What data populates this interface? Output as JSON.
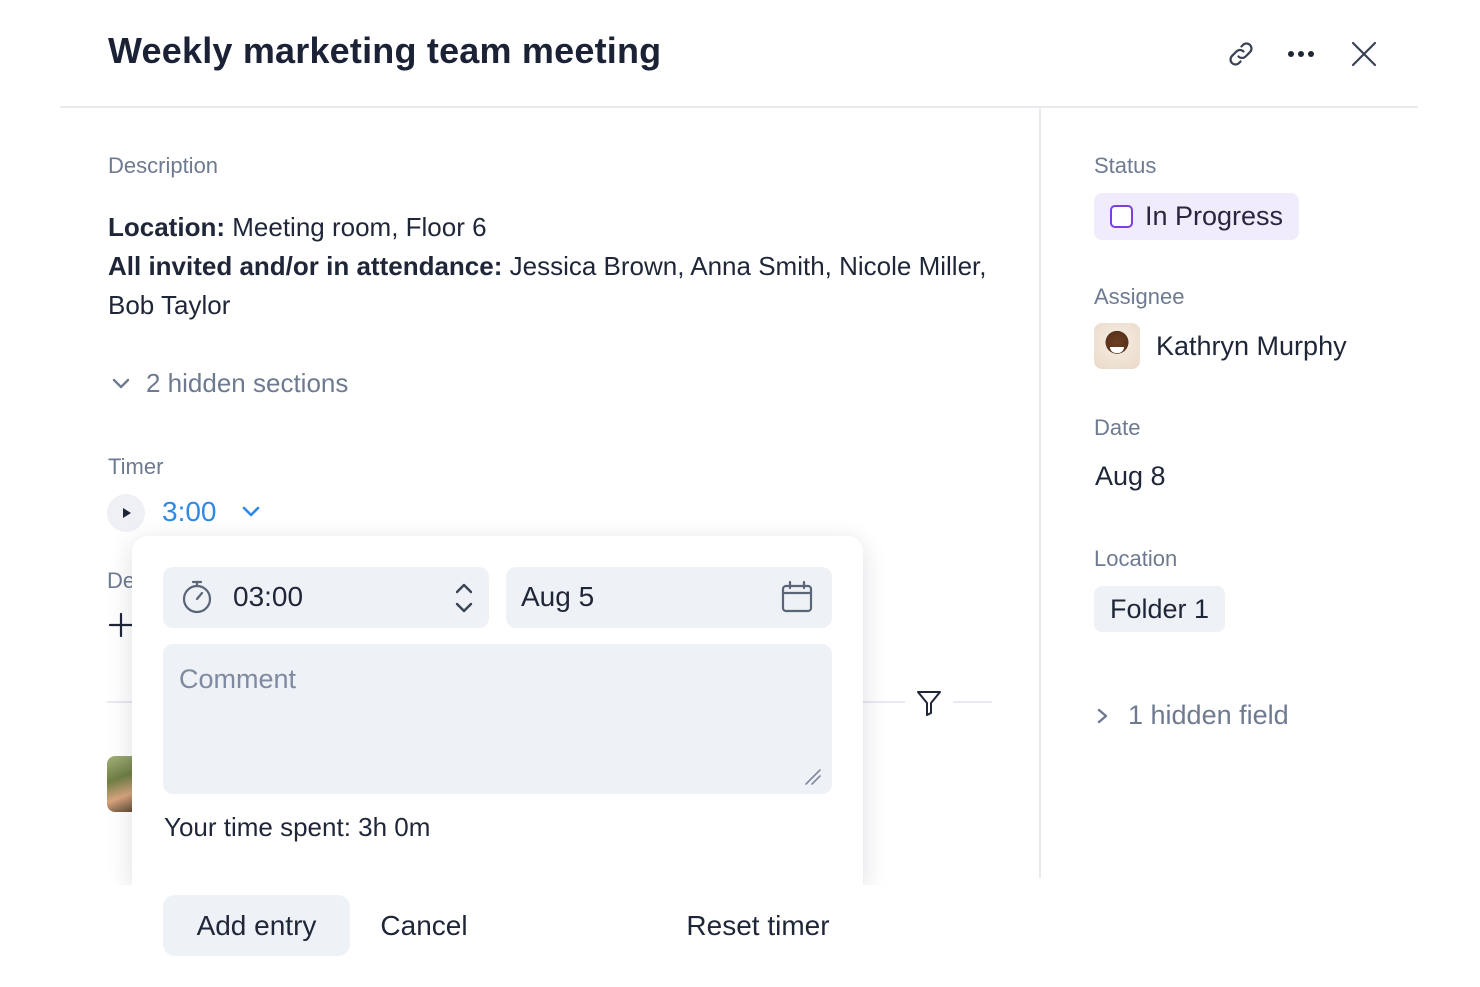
{
  "header": {
    "title": "Weekly marketing team meeting",
    "icons": [
      "link-icon",
      "more-icon",
      "close-icon"
    ]
  },
  "description": {
    "label": "Description",
    "location_label": "Location:",
    "location_value": "Meeting room, Floor 6",
    "invited_label": "All invited and/or in attendance:",
    "invited_value": "Jessica Brown, Anna Smith, Nicole Miller, Bob Taylor"
  },
  "hidden_sections": {
    "label": "2 hidden sections",
    "icon": "chevron-down-icon"
  },
  "timer": {
    "label": "Timer",
    "value": "3:00",
    "icons": [
      "play-icon",
      "chevron-down-icon"
    ]
  },
  "background_section": {
    "truncated_label": "De"
  },
  "time_entry": {
    "duration": "03:00",
    "date": "Aug 5",
    "comment_placeholder": "Comment",
    "time_spent": "Your time spent: 3h 0m",
    "add_label": "Add entry",
    "cancel_label": "Cancel",
    "reset_label": "Reset timer",
    "icons": [
      "stopwatch-icon",
      "stepper-icon",
      "calendar-icon"
    ]
  },
  "sidebar": {
    "status_label": "Status",
    "status_value": "In Progress",
    "assignee_label": "Assignee",
    "assignee_name": "Kathryn Murphy",
    "date_label": "Date",
    "date_value": "Aug 8",
    "location_label": "Location",
    "location_value": "Folder 1",
    "hidden_field": "1 hidden field"
  },
  "colors": {
    "accent_blue": "#2f8ae6",
    "status_purple": "#7b3fe0",
    "status_bg": "#f1ecfc",
    "field_bg": "#eef1f6",
    "muted_text": "#6e7a90"
  }
}
